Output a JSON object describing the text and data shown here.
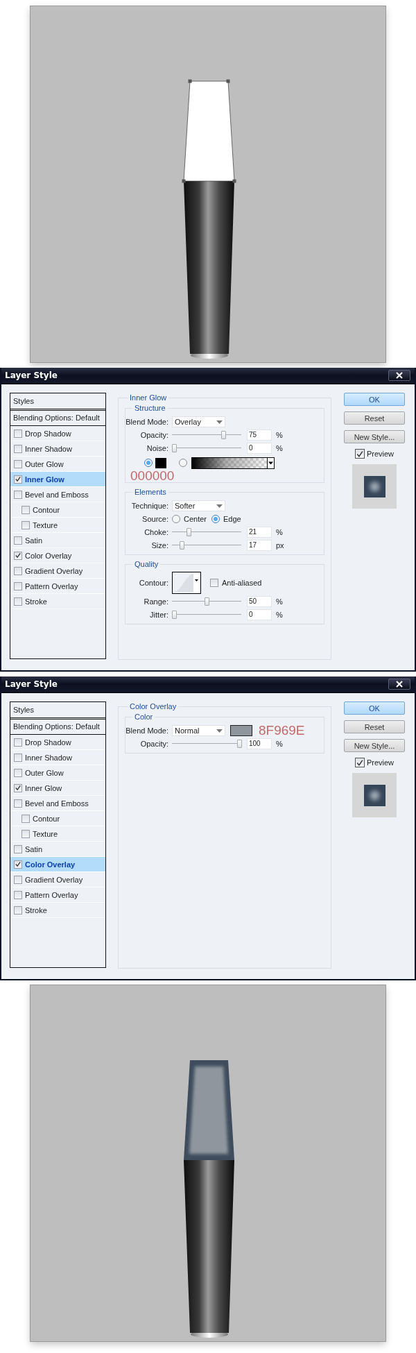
{
  "sections": [
    {
      "kind": "document",
      "cap": {
        "color": "#ffffff",
        "inner_glow": false
      },
      "selection_handles": true
    },
    {
      "kind": "dialog",
      "title": "Layer Style",
      "styles_header": "Styles",
      "blending_options": "Blending Options: Default",
      "effects": [
        {
          "label": "Drop Shadow",
          "checked": false,
          "selected": false
        },
        {
          "label": "Inner Shadow",
          "checked": false,
          "selected": false
        },
        {
          "label": "Outer Glow",
          "checked": false,
          "selected": false
        },
        {
          "label": "Inner Glow",
          "checked": true,
          "selected": true
        },
        {
          "label": "Bevel and Emboss",
          "checked": false,
          "selected": false,
          "children": [
            {
              "label": "Contour",
              "checked": false,
              "selected": false
            },
            {
              "label": "Texture",
              "checked": false,
              "selected": false
            }
          ]
        },
        {
          "label": "Satin",
          "checked": false,
          "selected": false
        },
        {
          "label": "Color Overlay",
          "checked": true,
          "selected": false
        },
        {
          "label": "Gradient Overlay",
          "checked": false,
          "selected": false
        },
        {
          "label": "Pattern Overlay",
          "checked": false,
          "selected": false
        },
        {
          "label": "Stroke",
          "checked": false,
          "selected": false
        }
      ],
      "panel": {
        "title": "Inner Glow",
        "groups": [
          {
            "title": "Structure",
            "rows": [
              {
                "kind": "dropdown",
                "label": "Blend Mode:",
                "value": "Overlay"
              },
              {
                "kind": "slider",
                "label": "Opacity:",
                "level": 0.76,
                "value": "75",
                "unit": "%"
              },
              {
                "kind": "slider",
                "label": "Noise:",
                "level": 0,
                "value": "0",
                "unit": "%"
              },
              {
                "kind": "fill",
                "options": [
                  {
                    "kind": "solid",
                    "selected": true,
                    "color": "#000000"
                  },
                  {
                    "kind": "gradient",
                    "selected": false
                  }
                ]
              },
              {
                "kind": "note",
                "text": "000000"
              }
            ]
          },
          {
            "title": "Elements",
            "rows": [
              {
                "kind": "dropdown",
                "label": "Technique:",
                "value": "Softer"
              },
              {
                "kind": "radios",
                "label": "Source:",
                "options": [
                  {
                    "label": "Center",
                    "selected": false
                  },
                  {
                    "label": "Edge",
                    "selected": true
                  }
                ]
              },
              {
                "kind": "slider",
                "label": "Choke:",
                "level": 0.22,
                "value": "21",
                "unit": "%"
              },
              {
                "kind": "slider",
                "label": "Size:",
                "level": 0.12,
                "value": "17",
                "unit": "px"
              }
            ]
          },
          {
            "title": "Quality",
            "rows": [
              {
                "kind": "contour",
                "label": "Contour:",
                "anti_aliased": {
                  "label": "Anti-aliased",
                  "checked": false
                }
              },
              {
                "kind": "slider",
                "label": "Range:",
                "level": 0.5,
                "value": "50",
                "unit": "%"
              },
              {
                "kind": "slider",
                "label": "Jitter:",
                "level": 0,
                "value": "0",
                "unit": "%"
              }
            ]
          }
        ]
      },
      "buttons": [
        {
          "label": "OK",
          "default": true
        },
        {
          "label": "Reset",
          "default": false
        },
        {
          "label": "New Style...",
          "default": false
        }
      ],
      "preview": {
        "label": "Preview",
        "checked": true
      }
    },
    {
      "kind": "dialog",
      "title": "Layer Style",
      "styles_header": "Styles",
      "blending_options": "Blending Options: Default",
      "effects": [
        {
          "label": "Drop Shadow",
          "checked": false,
          "selected": false
        },
        {
          "label": "Inner Shadow",
          "checked": false,
          "selected": false
        },
        {
          "label": "Outer Glow",
          "checked": false,
          "selected": false
        },
        {
          "label": "Inner Glow",
          "checked": true,
          "selected": false
        },
        {
          "label": "Bevel and Emboss",
          "checked": false,
          "selected": false,
          "children": [
            {
              "label": "Contour",
              "checked": false,
              "selected": false
            },
            {
              "label": "Texture",
              "checked": false,
              "selected": false
            }
          ]
        },
        {
          "label": "Satin",
          "checked": false,
          "selected": false
        },
        {
          "label": "Color Overlay",
          "checked": true,
          "selected": true
        },
        {
          "label": "Gradient Overlay",
          "checked": false,
          "selected": false
        },
        {
          "label": "Pattern Overlay",
          "checked": false,
          "selected": false
        },
        {
          "label": "Stroke",
          "checked": false,
          "selected": false
        }
      ],
      "panel": {
        "title": "Color Overlay",
        "groups": [
          {
            "title": "Color",
            "rows": [
              {
                "kind": "dropdown",
                "label": "Blend Mode:",
                "value": "Normal",
                "color": "#8f969e",
                "note": "8F969E"
              },
              {
                "kind": "slider",
                "label": "Opacity:",
                "level": 1,
                "value": "100",
                "unit": "%"
              }
            ]
          }
        ]
      },
      "buttons": [
        {
          "label": "OK",
          "default": true
        },
        {
          "label": "Reset",
          "default": false
        },
        {
          "label": "New Style...",
          "default": false
        }
      ],
      "preview": {
        "label": "Preview",
        "checked": true
      }
    },
    {
      "kind": "document",
      "cap": {
        "color": "#8f969e",
        "inner_glow": true
      },
      "selection_handles": false
    }
  ]
}
